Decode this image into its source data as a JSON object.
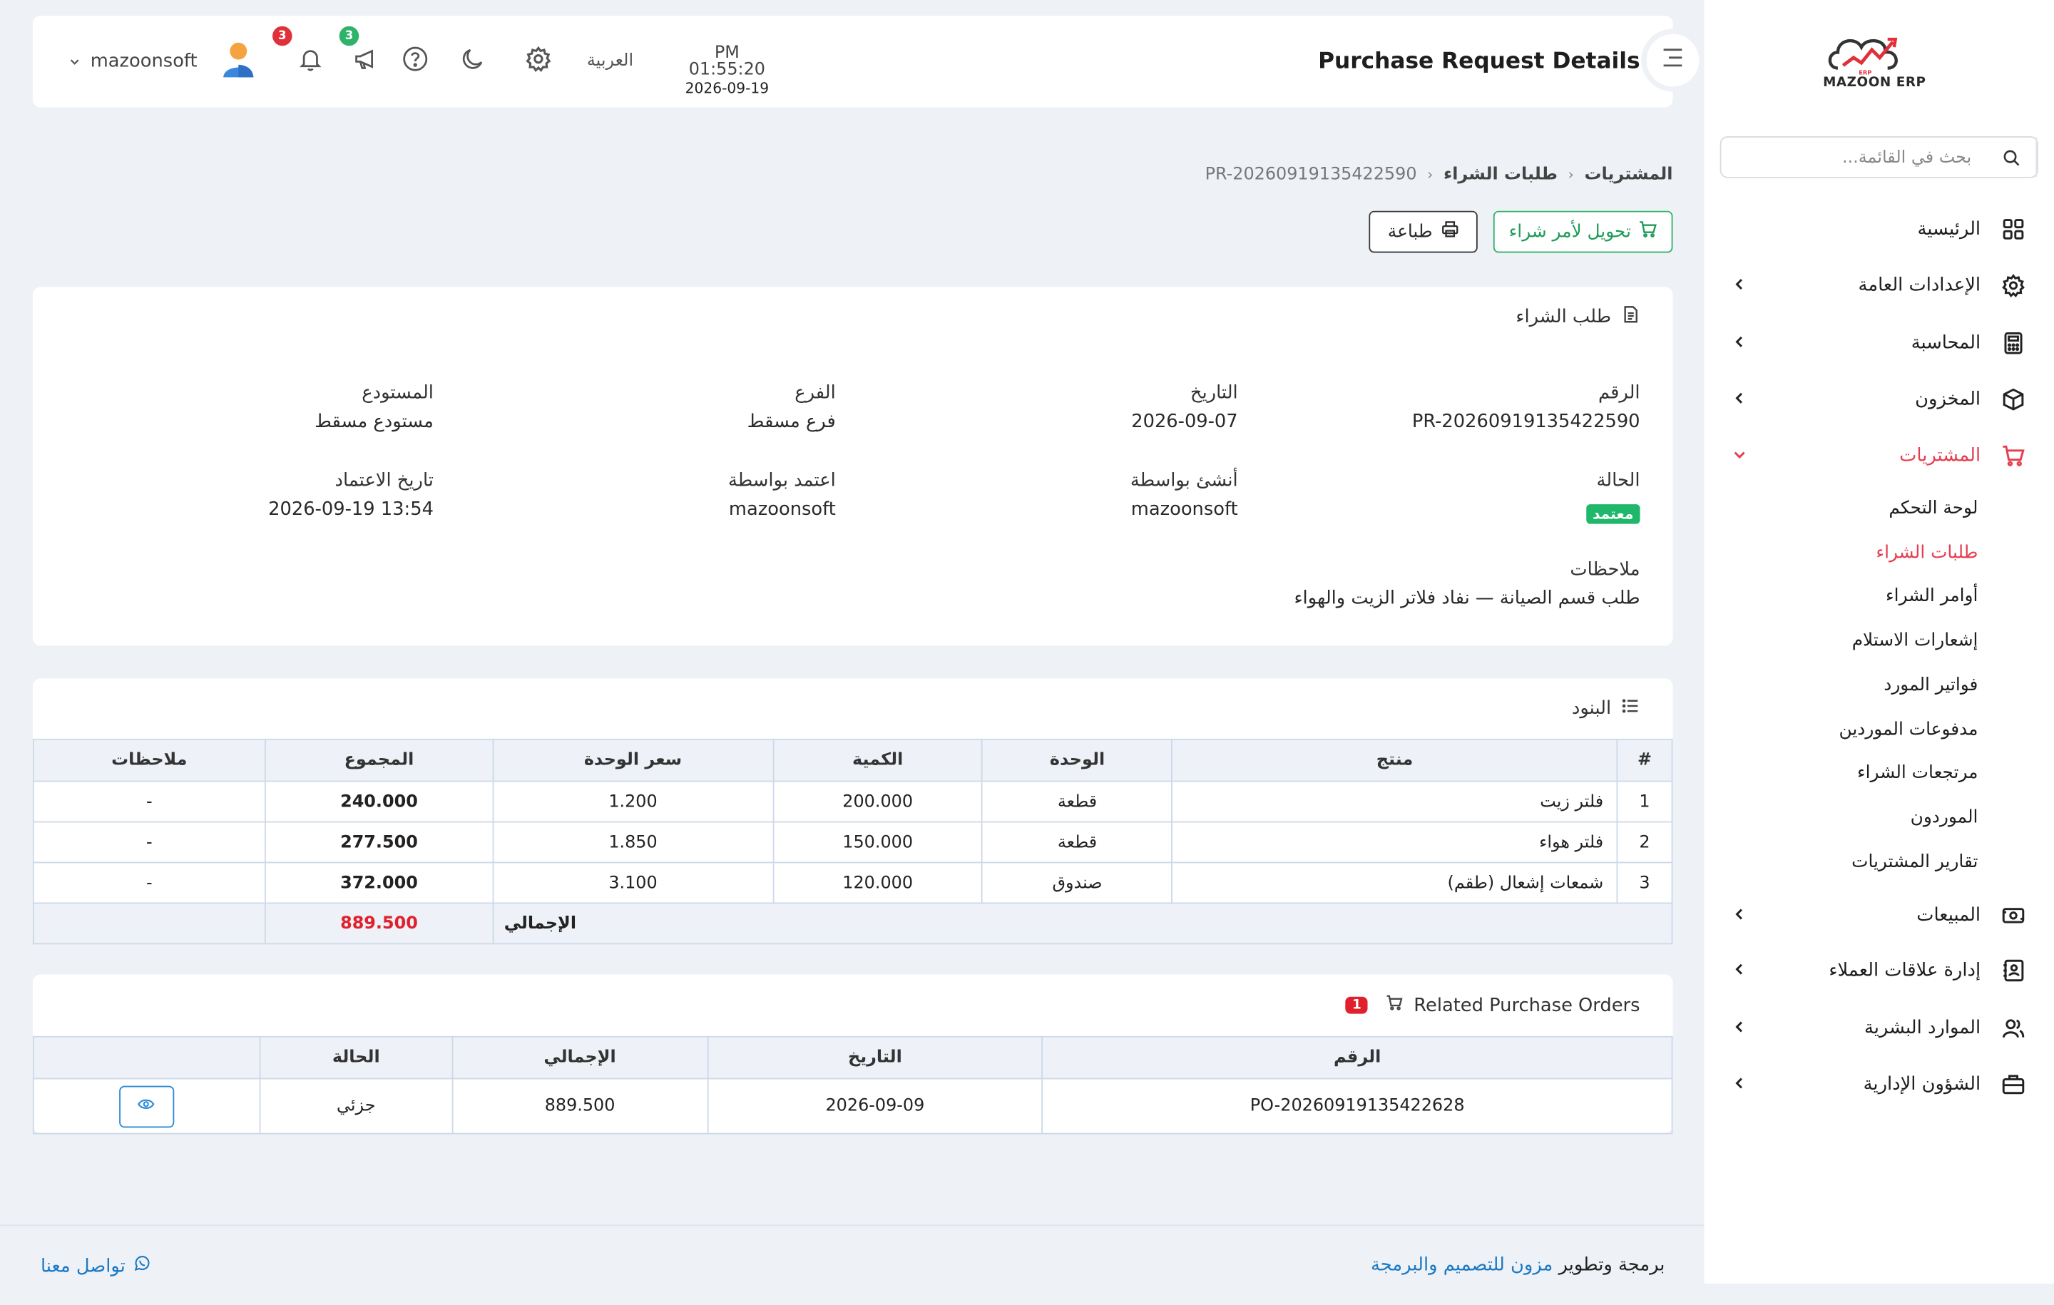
{
  "app": {
    "name": "MAZOON ERP",
    "logo_mini": "ERP"
  },
  "header": {
    "title": "Purchase Request Details",
    "time": "PM 01:55:20",
    "date": "2026-09-19",
    "language": "العربية",
    "notifications_count": "3",
    "announcements_count": "3",
    "user_name": "mazoonsoft"
  },
  "sidebar": {
    "search_placeholder": "بحث في القائمة...",
    "items": [
      {
        "label": "الرئيسية",
        "icon": "grid-icon",
        "has_children": false
      },
      {
        "label": "الإعدادات العامة",
        "icon": "gear-icon",
        "has_children": true
      },
      {
        "label": "المحاسبة",
        "icon": "calculator-icon",
        "has_children": true
      },
      {
        "label": "المخزون",
        "icon": "box-icon",
        "has_children": true
      },
      {
        "label": "المشتريات",
        "icon": "cart-icon",
        "has_children": true,
        "active": true
      },
      {
        "label": "المبيعات",
        "icon": "cash-icon",
        "has_children": true
      },
      {
        "label": "إدارة علاقات العملاء",
        "icon": "contacts-icon",
        "has_children": true
      },
      {
        "label": "الموارد البشرية",
        "icon": "users-icon",
        "has_children": true
      },
      {
        "label": "الشؤون الإدارية",
        "icon": "briefcase-icon",
        "has_children": true
      }
    ],
    "purchases_sub": [
      {
        "label": "لوحة التحكم"
      },
      {
        "label": "طلبات الشراء",
        "active": true
      },
      {
        "label": "أوامر الشراء"
      },
      {
        "label": "إشعارات الاستلام"
      },
      {
        "label": "فواتير المورد"
      },
      {
        "label": "مدفوعات الموردين"
      },
      {
        "label": "مرتجعات الشراء"
      },
      {
        "label": "الموردون"
      },
      {
        "label": "تقارير المشتريات"
      }
    ]
  },
  "breadcrumb": {
    "root": "المشتريات",
    "section": "طلبات الشراء",
    "current": "PR-20260919135422590"
  },
  "actions": {
    "convert_label": "تحويل لأمر شراء",
    "print_label": "طباعة"
  },
  "request": {
    "card_title": "طلب الشراء",
    "number_label": "الرقم",
    "number": "PR-20260919135422590",
    "date_label": "التاريخ",
    "date": "2026-09-07",
    "branch_label": "الفرع",
    "branch": "فرع مسقط",
    "warehouse_label": "المستودع",
    "warehouse": "مستودع مسقط",
    "status_label": "الحالة",
    "status": "معتمد",
    "status_color": "#1fb86a",
    "created_by_label": "أنشئ بواسطة",
    "created_by": "mazoonsoft",
    "approved_by_label": "اعتمد بواسطة",
    "approved_by": "mazoonsoft",
    "approval_date_label": "تاريخ الاعتماد",
    "approval_date": "13:54 2026-09-19",
    "notes_label": "ملاحظات",
    "notes": "طلب قسم الصيانة — نفاد فلاتر الزيت والهواء"
  },
  "items": {
    "title": "البنود",
    "headers": [
      "#",
      "منتج",
      "الوحدة",
      "الكمية",
      "سعر الوحدة",
      "المجموع",
      "ملاحظات"
    ],
    "rows": [
      {
        "no": "1",
        "product": "فلتر زيت",
        "unit": "قطعة",
        "qty": "200.000",
        "price": "1.200",
        "total": "240.000",
        "notes": "-"
      },
      {
        "no": "2",
        "product": "فلتر هواء",
        "unit": "قطعة",
        "qty": "150.000",
        "price": "1.850",
        "total": "277.500",
        "notes": "-"
      },
      {
        "no": "3",
        "product": "شمعات إشعال (طقم)",
        "unit": "صندوق",
        "qty": "120.000",
        "price": "3.100",
        "total": "372.000",
        "notes": "-"
      }
    ],
    "total_label": "الإجمالي",
    "grand_total": "889.500"
  },
  "related_orders": {
    "title": "Related Purchase Orders",
    "count": "1",
    "headers": [
      "الرقم",
      "التاريخ",
      "الإجمالي",
      "الحالة",
      ""
    ],
    "rows": [
      {
        "number": "PO-20260919135422628",
        "date": "2026-09-09",
        "total": "889.500",
        "status": "جزئي"
      }
    ]
  },
  "footer": {
    "credit_prefix": "برمجة وتطوير",
    "credit_link": "مزون للتصميم والبرمجة",
    "contact": "تواصل معنا"
  },
  "colors": {
    "accent": "#e53e4f",
    "green": "#1fb86a",
    "link": "#1b79c4",
    "danger": "#e0202d"
  }
}
